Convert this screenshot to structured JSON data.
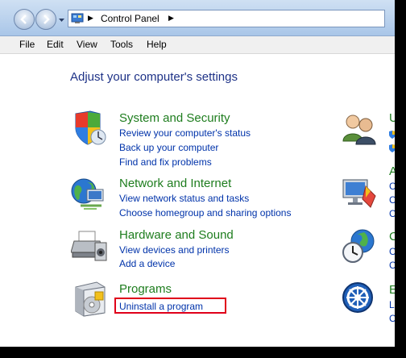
{
  "address_bar": {
    "path_root": "Control Panel"
  },
  "menu": {
    "items": [
      "File",
      "Edit",
      "View",
      "Tools",
      "Help"
    ]
  },
  "content": {
    "page_title": "Adjust your computer's settings",
    "categories": [
      {
        "title": "System and Security",
        "icon": "shield-icon",
        "links": [
          "Review your computer's status",
          "Back up your computer",
          "Find and fix problems"
        ]
      },
      {
        "title": "Network and Internet",
        "icon": "globe-network-icon",
        "links": [
          "View network status and tasks",
          "Choose homegroup and sharing options"
        ]
      },
      {
        "title": "Hardware and Sound",
        "icon": "printer-icon",
        "links": [
          "View devices and printers",
          "Add a device"
        ]
      },
      {
        "title": "Programs",
        "icon": "programs-box-icon",
        "links": [
          "Uninstall a program"
        ]
      }
    ],
    "right_column_partial": [
      {
        "icon": "users-icon",
        "head": "U",
        "lines": [
          "",
          ""
        ]
      },
      {
        "icon": "display-icon",
        "head": "A",
        "lines": [
          "C",
          "C",
          "C"
        ]
      },
      {
        "icon": "clock-globe-icon",
        "head": "C",
        "lines": [
          "C",
          "C"
        ]
      },
      {
        "icon": "ease-of-access-icon",
        "head": "E",
        "lines": [
          "L",
          "C"
        ]
      }
    ]
  },
  "colors": {
    "title_blue": "#1e3287",
    "category_green": "#1e7d1e",
    "link_blue": "#0033aa",
    "highlight_red": "#e0001a"
  }
}
